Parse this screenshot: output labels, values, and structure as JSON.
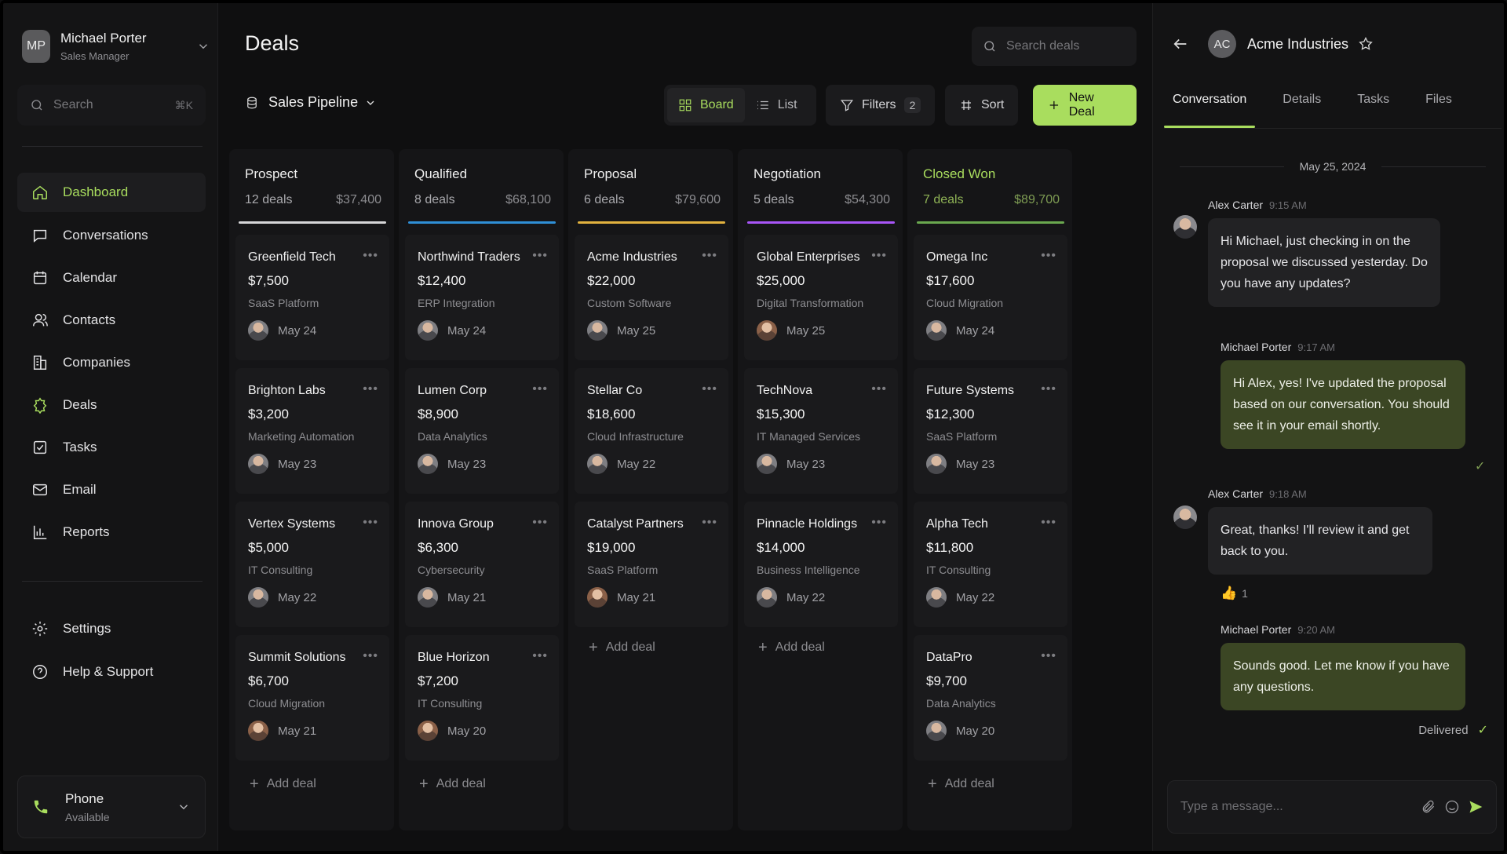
{
  "user": {
    "initials": "MP",
    "name": "Michael Porter",
    "role": "Sales Manager"
  },
  "sidebar": {
    "search_placeholder": "Search",
    "search_shortcut": "⌘K",
    "nav": [
      {
        "label": "Dashboard",
        "icon": "home-icon",
        "active": true
      },
      {
        "label": "Conversations",
        "icon": "chat-icon"
      },
      {
        "label": "Calendar",
        "icon": "calendar-icon"
      },
      {
        "label": "Contacts",
        "icon": "contacts-icon"
      },
      {
        "label": "Companies",
        "icon": "building-icon"
      },
      {
        "label": "Deals",
        "icon": "deals-icon"
      },
      {
        "label": "Tasks",
        "icon": "tasks-icon"
      },
      {
        "label": "Email",
        "icon": "mail-icon"
      },
      {
        "label": "Reports",
        "icon": "chart-icon"
      }
    ],
    "bottom": [
      {
        "label": "Settings",
        "icon": "gear-icon"
      },
      {
        "label": "Help & Support",
        "icon": "help-icon"
      }
    ],
    "phone": {
      "label": "Phone",
      "status": "Available"
    }
  },
  "header": {
    "title": "Deals",
    "search_placeholder": "Search deals",
    "pipeline": "Sales Pipeline",
    "view_board": "Board",
    "view_list": "List",
    "filters": "Filters",
    "filters_count": "2",
    "sort": "Sort",
    "new_deal": "New Deal"
  },
  "colors": {
    "accent": "#a9dd5e",
    "prospect": "#d6d6d8",
    "qualified": "#2f8fd6",
    "proposal": "#e2b23f",
    "negotiation": "#a855f7",
    "closed_won": "#6aa84f"
  },
  "board": {
    "add_deal": "Add deal",
    "columns": [
      {
        "title": "Prospect",
        "count": "12 deals",
        "amount": "$37,400",
        "color": "#d6d6d8",
        "cards": [
          {
            "name": "Greenfield Tech",
            "amount": "$7,500",
            "category": "SaaS Platform",
            "date": "May 24"
          },
          {
            "name": "Brighton Labs",
            "amount": "$3,200",
            "category": "Marketing Automation",
            "date": "May 23"
          },
          {
            "name": "Vertex Systems",
            "amount": "$5,000",
            "category": "IT Consulting",
            "date": "May 22"
          },
          {
            "name": "Summit Solutions",
            "amount": "$6,700",
            "category": "Cloud Migration",
            "date": "May 21"
          }
        ]
      },
      {
        "title": "Qualified",
        "count": "8 deals",
        "amount": "$68,100",
        "color": "#2f8fd6",
        "cards": [
          {
            "name": "Northwind Traders",
            "amount": "$12,400",
            "category": "ERP Integration",
            "date": "May 24"
          },
          {
            "name": "Lumen Corp",
            "amount": "$8,900",
            "category": "Data Analytics",
            "date": "May 23"
          },
          {
            "name": "Innova Group",
            "amount": "$6,300",
            "category": "Cybersecurity",
            "date": "May 21"
          },
          {
            "name": "Blue Horizon",
            "amount": "$7,200",
            "category": "IT Consulting",
            "date": "May 20"
          }
        ]
      },
      {
        "title": "Proposal",
        "count": "6 deals",
        "amount": "$79,600",
        "color": "#e2b23f",
        "cards": [
          {
            "name": "Acme Industries",
            "amount": "$22,000",
            "category": "Custom Software",
            "date": "May 25"
          },
          {
            "name": "Stellar Co",
            "amount": "$18,600",
            "category": "Cloud Infrastructure",
            "date": "May 22"
          },
          {
            "name": "Catalyst Partners",
            "amount": "$19,000",
            "category": "SaaS Platform",
            "date": "May 21"
          }
        ]
      },
      {
        "title": "Negotiation",
        "count": "5 deals",
        "amount": "$54,300",
        "color": "#a855f7",
        "cards": [
          {
            "name": "Global Enterprises",
            "amount": "$25,000",
            "category": "Digital Transformation",
            "date": "May 25"
          },
          {
            "name": "TechNova",
            "amount": "$15,300",
            "category": "IT Managed Services",
            "date": "May 23"
          },
          {
            "name": "Pinnacle Holdings",
            "amount": "$14,000",
            "category": "Business Intelligence",
            "date": "May 22"
          }
        ]
      },
      {
        "title": "Closed Won",
        "count": "7 deals",
        "amount": "$89,700",
        "color": "#6aa84f",
        "cards": [
          {
            "name": "Omega Inc",
            "amount": "$17,600",
            "category": "Cloud Migration",
            "date": "May 24"
          },
          {
            "name": "Future Systems",
            "amount": "$12,300",
            "category": "SaaS Platform",
            "date": "May 23"
          },
          {
            "name": "Alpha Tech",
            "amount": "$11,800",
            "category": "IT Consulting",
            "date": "May 22"
          },
          {
            "name": "DataPro",
            "amount": "$9,700",
            "category": "Data Analytics",
            "date": "May 20"
          }
        ]
      }
    ]
  },
  "panel": {
    "initials": "AC",
    "company": "Acme Industries",
    "tabs": [
      "Conversation",
      "Details",
      "Tasks",
      "Files"
    ],
    "date": "May 25, 2024",
    "messages": [
      {
        "author": "Alex Carter",
        "time": "9:15 AM",
        "text": "Hi Michael, just checking in on the proposal we discussed yesterday. Do you have any updates?"
      },
      {
        "author": "Michael Porter",
        "time": "9:17 AM",
        "text": "Hi Alex, yes! I've updated the proposal based on our conversation. You should see it in your email shortly."
      },
      {
        "author": "Alex Carter",
        "time": "9:18 AM",
        "text": "Great, thanks! I'll review it and get back to you.",
        "reaction": "👍",
        "reaction_count": "1"
      },
      {
        "author": "Michael Porter",
        "time": "9:20 AM",
        "text": "Sounds good. Let me know if you have any questions."
      }
    ],
    "delivered": "Delivered",
    "composer_placeholder": "Type a message..."
  }
}
